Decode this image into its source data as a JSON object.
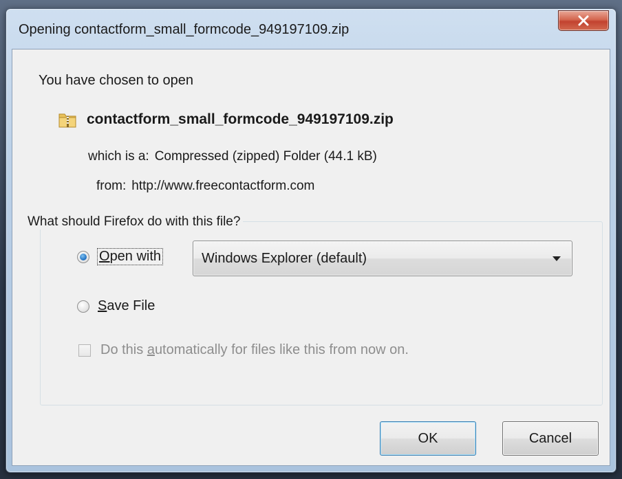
{
  "window": {
    "title": "Opening contactform_small_formcode_949197109.zip"
  },
  "dialog": {
    "intro": "You have chosen to open",
    "file_name": "contactform_small_formcode_949197109.zip",
    "which_label": "which is a:",
    "which_value": "Compressed (zipped) Folder (44.1  kB)",
    "from_label": "from:",
    "from_value": "http://www.freecontactform.com",
    "question": "What should Firefox do with this file?",
    "open_with": {
      "accel": "O",
      "rest": "pen with",
      "selected": true
    },
    "open_with_app": "Windows Explorer (default)",
    "save_file": {
      "accel": "S",
      "rest": "ave File",
      "selected": false
    },
    "auto_checkbox": {
      "pre": "Do this ",
      "accel": "a",
      "post": "utomatically for files like this from now on.",
      "checked": false,
      "enabled": false
    }
  },
  "buttons": {
    "ok": "OK",
    "cancel": "Cancel"
  },
  "colors": {
    "close_button": "#c24330",
    "radio_selected": "#1c6ec0",
    "disabled_text": "#8d8d8d"
  }
}
